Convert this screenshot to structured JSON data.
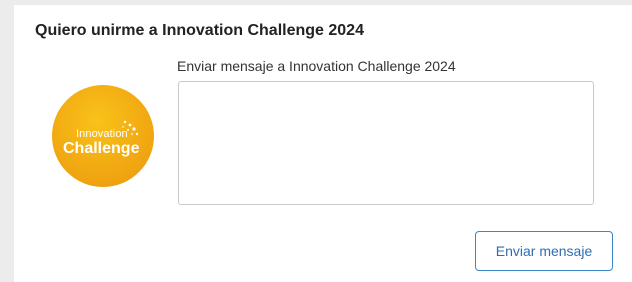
{
  "panel": {
    "title": "Quiero unirme a Innovation Challenge 2024"
  },
  "logo": {
    "line1": "Innovation",
    "line2": "Challenge",
    "background_color": "#f2aa12",
    "text_color": "#ffffff"
  },
  "message": {
    "label": "Enviar mensaje a Innovation Challenge 2024",
    "value": "",
    "placeholder": ""
  },
  "actions": {
    "send_label": "Enviar mensaje",
    "accent_color": "#3a86c8"
  }
}
